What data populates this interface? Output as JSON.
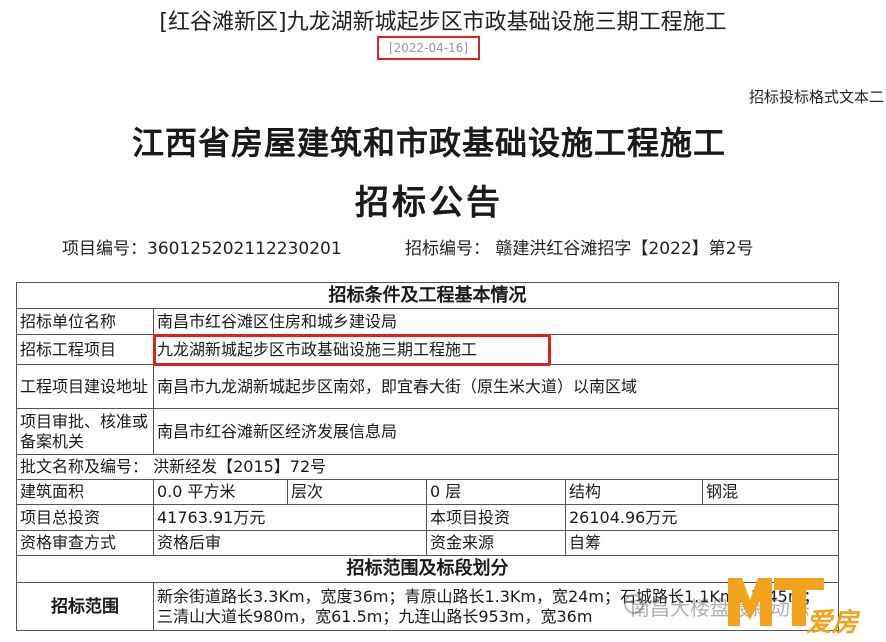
{
  "header": {
    "title": "[红谷滩新区]九龙湖新城起步区市政基础设施三期工程施工",
    "date": "[2022-04-16]",
    "doc_type": "招标投标格式文本二"
  },
  "heading": {
    "line1": "江西省房屋建筑和市政基础设施工程施工",
    "line2": "招标公告"
  },
  "meta": {
    "project_no": "项目编号：360125202112230201",
    "bid_no": "招标编号： 赣建洪红谷滩招字【2022】第2号"
  },
  "table": {
    "section1": "招标条件及工程基本情况",
    "tenderer_label": "招标单位名称",
    "tenderer_value": "南昌市红谷滩区住房和城乡建设局",
    "project_label": "招标工程项目",
    "project_value": "九龙湖新城起步区市政基础设施三期工程施工",
    "site_label": "工程项目建设地址",
    "site_value": "南昌市九龙湖新城起步区南郊，即宜春大街（原生米大道）以南区域",
    "approval_label": "项目审批、核准或备案机关",
    "approval_value": "南昌市红谷滩新区经济发展信息局",
    "doc_name": "批文名称及编号： 洪新经发【2015】72号",
    "area_label": "建筑面积",
    "area_value": "0.0 平方米",
    "floors_label": "层次",
    "floors_value": "0 层",
    "structure_label": "结构",
    "structure_value": "钢混",
    "total_inv_label": "项目总投资",
    "total_inv_value": "41763.91万元",
    "this_inv_label": "本项目投资",
    "this_inv_value": "26104.96万元",
    "qual_label": "资格审查方式",
    "qual_value": "资格后审",
    "fund_label": "资金来源",
    "fund_value": "自筹",
    "section2": "招标范围及标段划分",
    "scope_label": "招标范围",
    "scope_value": "新余街道路长3.3Km，宽度36m；青原山路长1.3Km，宽24m；石城路长1.1Km，宽45m；三清山大道长980m，宽61.5m；九连山路长953m，宽36m"
  },
  "watermark": {
    "text": "南昌大楼盘最新动态",
    "logo_text": "爱房"
  },
  "colors": {
    "highlight": "#e0201e",
    "border": "#555555",
    "logo": "#f2a31b"
  }
}
